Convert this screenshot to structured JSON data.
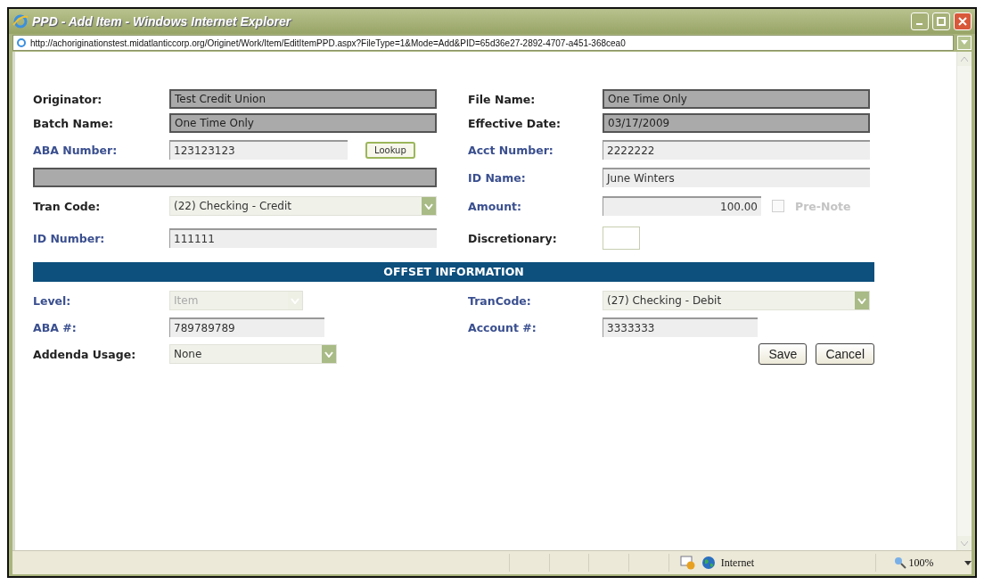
{
  "window": {
    "title": "PPD - Add Item - Windows Internet Explorer"
  },
  "address_bar": {
    "url": "http://achoriginationstest.midatlanticcorp.org/Originet/Work/Item/EditItemPPD.aspx?FileType=1&Mode=Add&PID=65d36e27-2892-4707-a451-368cea0"
  },
  "form": {
    "rows": [
      [
        {
          "label": "Originator:",
          "color": "#222222",
          "kind": "readonly",
          "value": "Test Credit Union"
        },
        {
          "label": "File Name:",
          "color": "#222222",
          "kind": "readonly",
          "value": "One Time Only"
        }
      ],
      [
        {
          "label": "Batch Name:",
          "color": "#222222",
          "kind": "readonly",
          "value": "One Time Only"
        },
        {
          "label": "Effective Date:",
          "color": "#222222",
          "kind": "readonly",
          "value": "03/17/2009"
        }
      ],
      [
        {
          "label": "ABA Number:",
          "color": "#3a4f8f",
          "kind": "lookup",
          "value": "123123123",
          "button": "Lookup"
        },
        {
          "label": "Acct Number:",
          "color": "#3a4f8f",
          "kind": "text",
          "value": "2222222"
        }
      ],
      [
        {
          "kind": "bar"
        },
        {
          "label": "ID Name:",
          "color": "#3a4f8f",
          "kind": "text",
          "value": "June Winters"
        }
      ],
      [
        {
          "label": "Tran Code:",
          "color": "#222222",
          "kind": "select",
          "value": "(22) Checking - Credit"
        },
        {
          "label": "Amount:",
          "color": "#3a4f8f",
          "kind": "amount",
          "value": "100.00",
          "prenote": {
            "label": "Pre-Note",
            "checked": false,
            "disabled": true
          }
        }
      ],
      [
        {
          "label": "ID Number:",
          "color": "#3a4f8f",
          "kind": "text",
          "value": "111111"
        },
        {
          "label": "Discretionary:",
          "color": "#222222",
          "kind": "tiny"
        }
      ]
    ]
  },
  "offset": {
    "title": "OFFSET INFORMATION",
    "rows": [
      [
        {
          "label": "Level:",
          "color": "#3a4f8f",
          "kind": "select-short",
          "value": "Item",
          "disabled": true
        },
        {
          "label": "TranCode:",
          "color": "#3a4f8f",
          "kind": "select",
          "value": "(27) Checking - Debit"
        }
      ],
      [
        {
          "label": "ABA #:",
          "color": "#3a4f8f",
          "kind": "text-short",
          "value": "789789789"
        },
        {
          "label": "Account #:",
          "color": "#3a4f8f",
          "kind": "text-short",
          "value": "3333333"
        }
      ],
      [
        {
          "label": "Addenda Usage:",
          "color": "#222222",
          "kind": "select-mid",
          "value": "None"
        },
        {
          "kind": "buttons",
          "buttons": [
            "Save",
            "Cancel"
          ]
        }
      ]
    ]
  },
  "status_bar": {
    "zone": "Internet",
    "zoom": "100%"
  }
}
